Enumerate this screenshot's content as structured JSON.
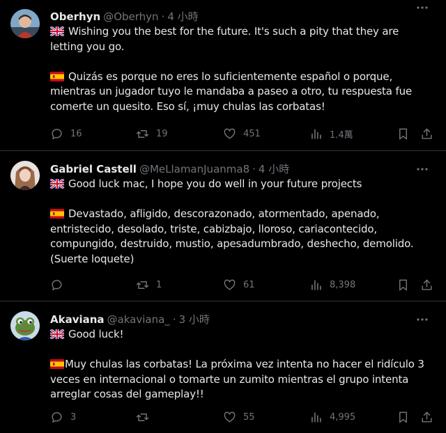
{
  "colors": {
    "background": "#000000",
    "text": "#e7e9ea",
    "muted": "#71767b",
    "divider": "#2f3336"
  },
  "tweets": [
    {
      "name": "Oberhyn",
      "handle": "@Oberhyn",
      "time": "4 小時",
      "avatar_icon": "avatar-person-icon",
      "paragraphs": [
        {
          "flag": "uk-flag-icon",
          "text": "Wishing you the best for the future. It's such a pity that they are letting you go."
        },
        {
          "flag": "spain-flag-icon",
          "text": "Quizás es porque no eres lo suficientemente español o porque, mientras un jugador tuyo le mandaba a paseo a otro, tu respuesta fue comerte un quesito. Eso sí, ¡muy chulas las corbatas!"
        }
      ],
      "replies": "16",
      "retweets": "19",
      "likes": "451",
      "views": "1.4萬"
    },
    {
      "name": "Gabriel Castell",
      "handle": "@MeLlamanJuanma8",
      "time": "4 小時",
      "avatar_icon": "avatar-woman-icon",
      "paragraphs": [
        {
          "flag": "uk-flag-icon",
          "text": "Good luck mac, I hope you do well in your future projects"
        },
        {
          "flag": "spain-flag-icon",
          "text": "Devastado, afligido, descorazonado, atormentado, apenado, entristecido, desolado, triste, cabizbajo, lloroso, cariacontecido, compungido, destruido, mustio, apesadumbrado, deshecho, demolido. (Suerte loquete)"
        }
      ],
      "replies": "",
      "retweets": "1",
      "likes": "61",
      "views": "8,398"
    },
    {
      "name": "Akaviana",
      "handle": "@akaviana_",
      "time": "3 小時",
      "avatar_icon": "avatar-frog-icon",
      "paragraphs": [
        {
          "flag": "uk-flag-icon",
          "text": "Good luck!"
        },
        {
          "flag": "spain-flag-icon",
          "text": "Muy chulas las corbatas! La próxima vez intenta no hacer el ridículo 3 veces en internacional o tomarte un zumito mientras el grupo intenta arreglar cosas del gameplay!!"
        }
      ],
      "replies": "3",
      "retweets": "",
      "likes": "55",
      "views": "4,995"
    }
  ]
}
